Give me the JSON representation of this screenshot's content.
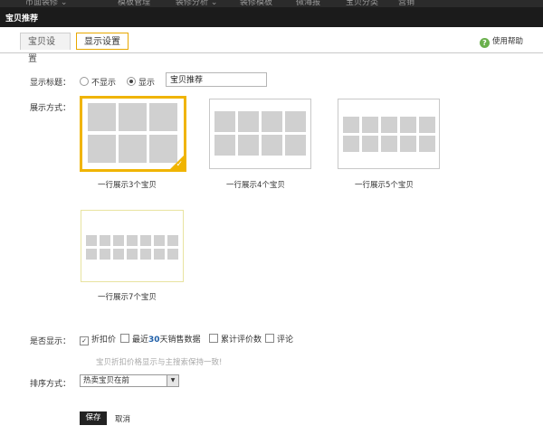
{
  "topnav": {
    "items": [
      "市面装修 ⌄",
      "模板管理",
      "装修分析 ⌄",
      "装修模板",
      "微海报",
      "宝贝分类",
      "营销"
    ]
  },
  "window": {
    "title": "宝贝推荐"
  },
  "tabs": [
    {
      "label": "宝贝设置"
    },
    {
      "label": "显示设置"
    }
  ],
  "help": {
    "label": "使用帮助",
    "icon": "?"
  },
  "title_row": {
    "label": "显示标题：",
    "hide_label": "不显示",
    "show_label": "显示",
    "input_value": "宝贝推荐"
  },
  "layout": {
    "label": "展示方式：",
    "options": [
      {
        "caption": "一行展示3个宝贝"
      },
      {
        "caption": "一行展示4个宝贝"
      },
      {
        "caption": "一行展示5个宝贝"
      },
      {
        "caption": "一行展示7个宝贝"
      }
    ],
    "selected_index": 0,
    "accent": "#f0b400"
  },
  "display": {
    "label": "是否显示：",
    "options": [
      {
        "prefix": "折扣价",
        "highlight": "",
        "suffix": "",
        "checked": true
      },
      {
        "prefix": "最近",
        "highlight": "30",
        "suffix": "天销售数据",
        "checked": false
      },
      {
        "prefix": "累计评价数",
        "highlight": "",
        "suffix": "",
        "checked": false
      },
      {
        "prefix": "评论",
        "highlight": "",
        "suffix": "",
        "checked": false
      }
    ],
    "hint": "宝贝折扣价格显示与主搜索保持一致!"
  },
  "sort": {
    "label": "排序方式：",
    "value": "热卖宝贝在前"
  },
  "actions": {
    "save": "保存",
    "cancel": "取消"
  }
}
